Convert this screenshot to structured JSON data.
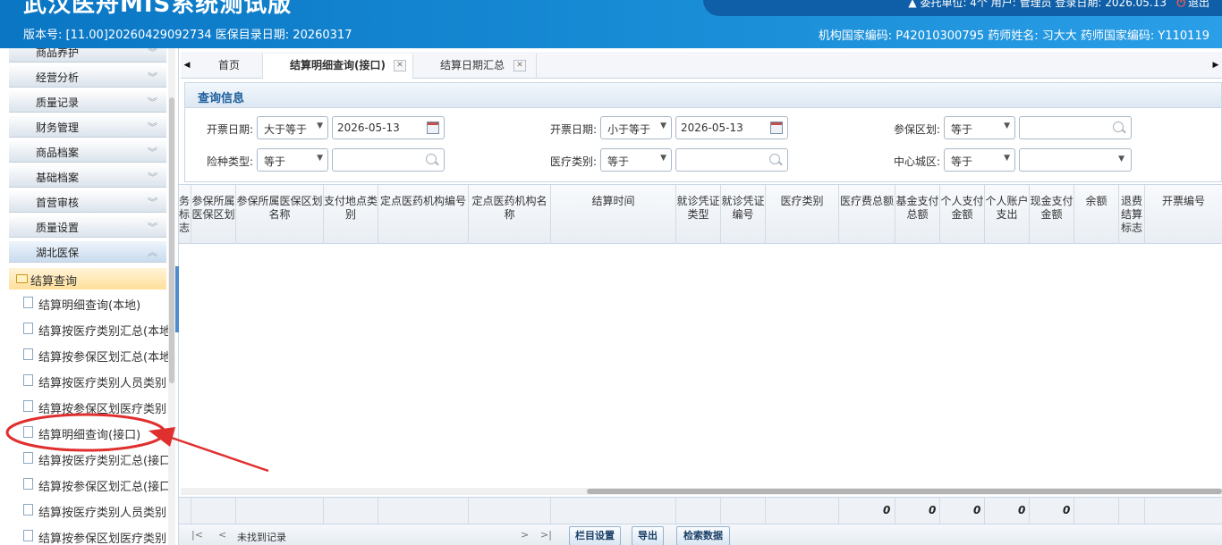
{
  "header": {
    "title": "武汉医舟MIS系统测试版",
    "version": "版本号: [11.00]20260429092734 医保目录日期: 20260317",
    "top_info": "委托单位: 4个 用户: 管理员 登录日期: 2026.05.13",
    "logout": "退出",
    "org_info": "机构国家编码: P42010300795 药师姓名: 习大大 药师国家编码: Y110119"
  },
  "sidebar": {
    "accordion": [
      "商品养护",
      "经营分析",
      "质量记录",
      "财务管理",
      "商品档案",
      "基础档案",
      "首营审核",
      "质量设置",
      "湖北医保"
    ],
    "folder": "结算查询",
    "items": [
      "结算明细查询(本地)",
      "结算按医疗类别汇总(本地",
      "结算按参保区划汇总(本地",
      "结算按医疗类别人员类别",
      "结算按参保区划医疗类别",
      "结算明细查询(接口)",
      "结算按医疗类别汇总(接口",
      "结算按参保区划汇总(接口",
      "结算按医疗类别人员类别",
      "结算按参保区划医疗类别"
    ]
  },
  "tabs": [
    "首页",
    "结算明细查询(接口)",
    "结算日期汇总"
  ],
  "query": {
    "title": "查询信息",
    "row1": {
      "label1": "开票日期:",
      "op1": "大于等于",
      "date1": "2026-05-13",
      "label2": "开票日期:",
      "op2": "小于等于",
      "date2": "2026-05-13",
      "label3": "参保区划:",
      "op3": "等于",
      "value3": ""
    },
    "row2": {
      "label1": "险种类型:",
      "op1": "等于",
      "value1": "",
      "label2": "医疗类别:",
      "op2": "等于",
      "value2": "",
      "label3": "中心城区:",
      "op3": "等于",
      "value3": ""
    }
  },
  "grid": {
    "columns": [
      "务\n标\n志",
      "参保所属\n医保区划",
      "参保所属医保区划\n名称",
      "支付地点类\n别",
      "定点医药机构编号",
      "定点医药机构名\n称",
      "结算时间",
      "就诊凭证\n类型",
      "就诊凭证\n编号",
      "医疗类别",
      "医疗费总额",
      "基金支付\n总额",
      "个人支付\n金额",
      "个人账户\n支出",
      "现金支付\n金额",
      "余额",
      "退费\n结算\n标志",
      "开票编号"
    ],
    "totals": [
      "0",
      "0",
      "0",
      "0",
      "0"
    ]
  },
  "pager": {
    "first": "|<",
    "prev": "<",
    "status": "未找到记录",
    "next": ">",
    "last": ">|",
    "buttons": [
      "栏目设置",
      "导出",
      "检索数据"
    ]
  },
  "colors": {
    "header_bg": "#1a8fd8",
    "annotation": "#e02f2f",
    "accent": "#1c5d9c"
  }
}
